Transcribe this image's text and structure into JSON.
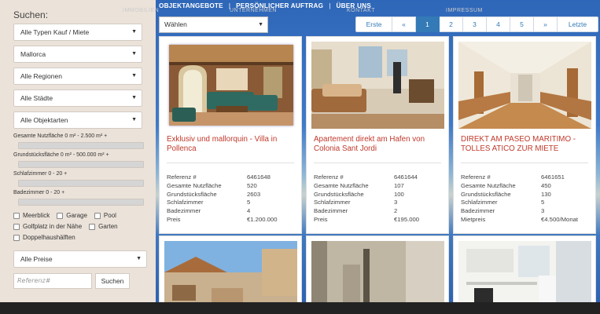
{
  "sidebar": {
    "title": "Suchen:",
    "type_select": "Alle Typen Kauf / Miete",
    "island_select": "Mallorca",
    "region_select": "Alle Regionen",
    "city_select": "Alle Städte",
    "objtype_select": "Alle Objektarten",
    "ranges": [
      {
        "label": "Gesamte Nutzfläche 0  m²  - 2.500 m² +"
      },
      {
        "label": "Grundstücksfläche 0  m²  - 500.000 m² +"
      },
      {
        "label": "Schlafzimmer 0  - 20 +"
      },
      {
        "label": "Badezimmer 0  - 20 +"
      }
    ],
    "checks": {
      "meerblick": "Meerblick",
      "garage": "Garage",
      "pool": "Pool",
      "golf": "Golfplatz in der Nähe",
      "garten": "Garten",
      "doppelhaus": "Doppelhaushälften"
    },
    "price_select": "Alle Preise",
    "ref_placeholder": "Referenz#",
    "search_button": "Suchen"
  },
  "topnav": {
    "item1": "OBJEKTANGEBOTE",
    "item2": "PERSÖNLICHER AUFTRAG",
    "item3": "ÜBER UNS",
    "sep": "|"
  },
  "sort_select": "Wählen",
  "pager": {
    "first": "Erste",
    "prev": "«",
    "p1": "1",
    "p2": "2",
    "p3": "3",
    "p4": "4",
    "p5": "5",
    "next": "»",
    "last": "Letzte"
  },
  "listings": [
    {
      "title": "Exklusiv und mallorquin - Villa in Pollenca",
      "facts": [
        {
          "label": "Referenz #",
          "value": "6461648"
        },
        {
          "label": "Gesamte Nutzfläche",
          "value": "520"
        },
        {
          "label": "Grundstücksfläche",
          "value": "2603"
        },
        {
          "label": "Schlafzimmer",
          "value": "5"
        },
        {
          "label": "Badezimmer",
          "value": "4"
        },
        {
          "label": "Preis",
          "value": "€1.200.000"
        }
      ]
    },
    {
      "title": "Apartement direkt am Hafen von Colonia Sant Jordi",
      "facts": [
        {
          "label": "Referenz #",
          "value": "6461644"
        },
        {
          "label": "Gesamte Nutzfläche",
          "value": "107"
        },
        {
          "label": "Grundstücksfläche",
          "value": "100"
        },
        {
          "label": "Schlafzimmer",
          "value": "3"
        },
        {
          "label": "Badezimmer",
          "value": "2"
        },
        {
          "label": "Preis",
          "value": "€195.000"
        }
      ]
    },
    {
      "title": "DIREKT AM PASEO MARITIMO - TOLLES ATICO ZUR MIETE",
      "facts": [
        {
          "label": "Referenz #",
          "value": "6461651"
        },
        {
          "label": "Gesamte Nutzfläche",
          "value": "450"
        },
        {
          "label": "Grundstücksfläche",
          "value": "130"
        },
        {
          "label": "Schlafzimmer",
          "value": "5"
        },
        {
          "label": "Badezimmer",
          "value": "3"
        },
        {
          "label": "Mietpreis",
          "value": "€4.500/Monat"
        }
      ]
    }
  ],
  "footer": {
    "link1": "IMMOBILIEN",
    "link2": "UNTERNEHMEN",
    "link3": "KONTAKT",
    "link4": "IMPRESSUM"
  }
}
